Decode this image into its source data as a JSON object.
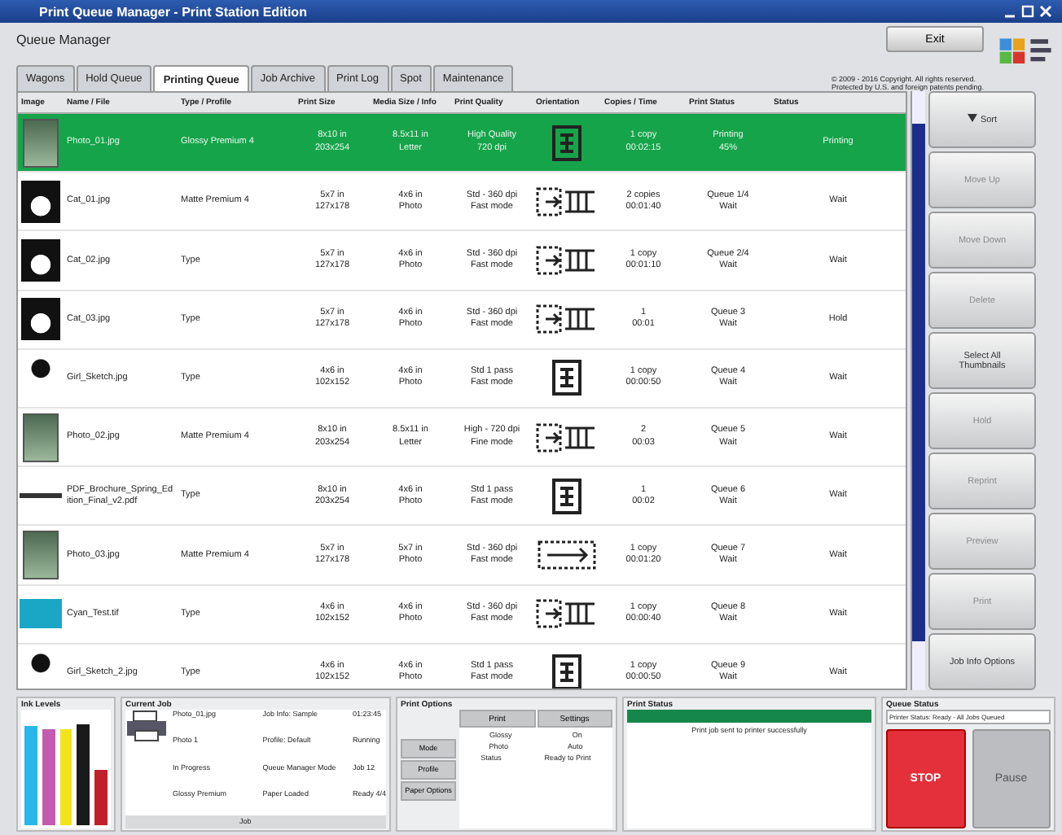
{
  "window": {
    "title": "Print Queue Manager - Print Station Edition"
  },
  "header": {
    "title": "Queue Manager",
    "exit_button": "Exit",
    "notice": [
      "© 2009 - 2016 Copyright. All rights reserved.",
      "Protected by U.S. and foreign patents pending."
    ]
  },
  "tabs": [
    {
      "label": "Wagons",
      "selected": false
    },
    {
      "label": "Hold Queue",
      "selected": false
    },
    {
      "label": "Printing Queue",
      "selected": true
    },
    {
      "label": "Job Archive",
      "selected": false
    },
    {
      "label": "Print Log",
      "selected": false
    },
    {
      "label": "Spot",
      "selected": false
    },
    {
      "label": "Maintenance",
      "selected": false
    }
  ],
  "table": {
    "columns": [
      "Image",
      "Name / File",
      "Type / Profile",
      "Print Size",
      "Media Size / Info",
      "Print Quality",
      "Orientation",
      "Copies / Time",
      "Print Status",
      "Status"
    ],
    "rows": [
      {
        "selected": true,
        "thumb": {
          "kind": "photo"
        },
        "name": "Photo_01.jpg",
        "type": "Glossy Premium 4",
        "size": [
          "8x10 in",
          "203x254"
        ],
        "media": [
          "8.5x11 in",
          "Letter"
        ],
        "quality": [
          "High Quality",
          "720 dpi"
        ],
        "orient": {
          "kind": "portrait"
        },
        "copies": [
          "1 copy",
          "00:02:15"
        ],
        "progress": [
          "Printing",
          "45%"
        ],
        "status": "Printing"
      },
      {
        "selected": false,
        "thumb": {
          "kind": "cat"
        },
        "name": "Cat_01.jpg",
        "type": "Matte Premium 4",
        "size": [
          "5x7 in",
          "127x178"
        ],
        "media": [
          "4x6 in",
          "Photo"
        ],
        "quality": [
          "Std - 360 dpi",
          "Fast mode"
        ],
        "orient": {
          "kind": "landscape"
        },
        "copies": [
          "2 copies",
          "00:01:40"
        ],
        "progress": [
          "Queue 1/4",
          "Wait"
        ],
        "status": "Wait"
      },
      {
        "selected": false,
        "thumb": {
          "kind": "cat"
        },
        "name": "Cat_02.jpg",
        "type": "Type",
        "size": [
          "5x7 in",
          "127x178"
        ],
        "media": [
          "4x6 in",
          "Photo"
        ],
        "quality": [
          "Std - 360 dpi",
          "Fast mode"
        ],
        "orient": {
          "kind": "landscape"
        },
        "copies": [
          "1 copy",
          "00:01:10"
        ],
        "progress": [
          "Queue 2/4",
          "Wait"
        ],
        "status": "Wait"
      },
      {
        "selected": false,
        "thumb": {
          "kind": "cat"
        },
        "name": "Cat_03.jpg",
        "type": "Type",
        "size": [
          "5x7 in",
          "127x178"
        ],
        "media": [
          "4x6 in",
          "Photo"
        ],
        "quality": [
          "Std - 360 dpi",
          "Fast mode"
        ],
        "orient": {
          "kind": "landscape"
        },
        "copies": [
          "1",
          "00:01"
        ],
        "progress": [
          "Queue 3",
          "Wait"
        ],
        "status": "Hold"
      },
      {
        "selected": false,
        "thumb": {
          "kind": "portrait"
        },
        "name": "Girl_Sketch.jpg",
        "type": "Type",
        "size": [
          "4x6 in",
          "102x152"
        ],
        "media": [
          "4x6 in",
          "Photo"
        ],
        "quality": [
          "Std 1 pass",
          "Fast mode"
        ],
        "orient": {
          "kind": "portrait"
        },
        "copies": [
          "1 copy",
          "00:00:50"
        ],
        "progress": [
          "Queue 4",
          "Wait"
        ],
        "status": "Wait"
      },
      {
        "selected": false,
        "thumb": {
          "kind": "photo"
        },
        "name": "Photo_02.jpg",
        "type": "Matte Premium 4",
        "size": [
          "8x10 in",
          "203x254"
        ],
        "media": [
          "8.5x11 in",
          "Letter"
        ],
        "quality": [
          "High - 720 dpi",
          "Fine mode"
        ],
        "orient": {
          "kind": "landscape"
        },
        "copies": [
          "2",
          "00:03"
        ],
        "progress": [
          "Queue 5",
          "Wait"
        ],
        "status": "Wait"
      },
      {
        "selected": false,
        "thumb": {
          "kind": "line"
        },
        "name": "PDF_Brochure_Spring_Edition_Final_v2.pdf",
        "type": "Type",
        "size": [
          "8x10 in",
          "203x254"
        ],
        "media": [
          "4x6 in",
          "Photo"
        ],
        "quality": [
          "Std 1 pass",
          "Fast mode"
        ],
        "orient": {
          "kind": "portrait"
        },
        "copies": [
          "1",
          "00:02"
        ],
        "progress": [
          "Queue 6",
          "Wait"
        ],
        "status": "Wait"
      },
      {
        "selected": false,
        "thumb": {
          "kind": "photo"
        },
        "name": "Photo_03.jpg",
        "type": "Matte Premium 4",
        "size": [
          "5x7 in",
          "127x178"
        ],
        "media": [
          "5x7 in",
          "Photo"
        ],
        "quality": [
          "Std - 360 dpi",
          "Fast mode"
        ],
        "orient": {
          "kind": "wide"
        },
        "copies": [
          "1 copy",
          "00:01:20"
        ],
        "progress": [
          "Queue 7",
          "Wait"
        ],
        "status": "Wait"
      },
      {
        "selected": false,
        "thumb": {
          "kind": "cyan"
        },
        "name": "Cyan_Test.tif",
        "type": "Type",
        "size": [
          "4x6 in",
          "102x152"
        ],
        "media": [
          "4x6 in",
          "Photo"
        ],
        "quality": [
          "Std - 360 dpi",
          "Fast mode"
        ],
        "orient": {
          "kind": "landscape"
        },
        "copies": [
          "1 copy",
          "00:00:40"
        ],
        "progress": [
          "Queue 8",
          "Wait"
        ],
        "status": "Wait"
      },
      {
        "selected": false,
        "thumb": {
          "kind": "portrait"
        },
        "name": "Girl_Sketch_2.jpg",
        "type": "Type",
        "size": [
          "4x6 in",
          "102x152"
        ],
        "media": [
          "4x6 in",
          "Photo"
        ],
        "quality": [
          "Std 1 pass",
          "Fast mode"
        ],
        "orient": {
          "kind": "portrait"
        },
        "copies": [
          "1 copy",
          "00:00:50"
        ],
        "progress": [
          "Queue 9",
          "Wait"
        ],
        "status": "Wait"
      }
    ]
  },
  "side_buttons": [
    {
      "label": "Sort",
      "disabled": false,
      "caret": true
    },
    {
      "label": "Move Up",
      "disabled": true
    },
    {
      "label": "Move Down",
      "disabled": true
    },
    {
      "label": "Delete",
      "disabled": true
    },
    {
      "label": "Select All Thumbnails",
      "disabled": false
    },
    {
      "label": "Hold",
      "disabled": true
    },
    {
      "label": "Reprint",
      "disabled": true
    },
    {
      "label": "Preview",
      "disabled": true
    },
    {
      "label": "Print",
      "disabled": true
    },
    {
      "label": "Job Info Options",
      "disabled": false
    }
  ],
  "ink": {
    "title": "Ink Levels",
    "inks": [
      {
        "color": "#29b6e8",
        "level": 0.88
      },
      {
        "color": "#c45bb0",
        "level": 0.86
      },
      {
        "color": "#f2e41c",
        "level": 0.86
      },
      {
        "color": "#1a1a1a",
        "level": 0.9
      },
      {
        "color": "#c0202a",
        "level": 0.5
      }
    ]
  },
  "current_job": {
    "title": "Current Job",
    "lines": [
      [
        "Photo_01.jpg",
        "Job Info: Sample",
        "01:23:45"
      ],
      [
        "Photo 1",
        "Profile: Default",
        "Running"
      ],
      [
        "In Progress",
        "Queue Manager Mode",
        "Job 12"
      ],
      [
        "Glossy Premium",
        "Paper Loaded",
        "Ready 4/4"
      ]
    ],
    "footer": "Job"
  },
  "print_options": {
    "title": "Print Options",
    "buttons": [
      "Print",
      "Settings"
    ],
    "side": [
      "Mode",
      "Profile",
      "Paper Options"
    ],
    "rows": [
      [
        "Glossy",
        "On"
      ],
      [
        "Photo",
        "Auto"
      ],
      [
        "Status",
        "Ready to Print"
      ]
    ]
  },
  "print_status": {
    "title": "Print Status",
    "level": 1,
    "message": "Print job sent to printer successfully"
  },
  "queue_status": {
    "title": "Queue Status",
    "field": "Printer Status: Ready - All Jobs Queued",
    "stop": "STOP",
    "pause": "Pause"
  }
}
